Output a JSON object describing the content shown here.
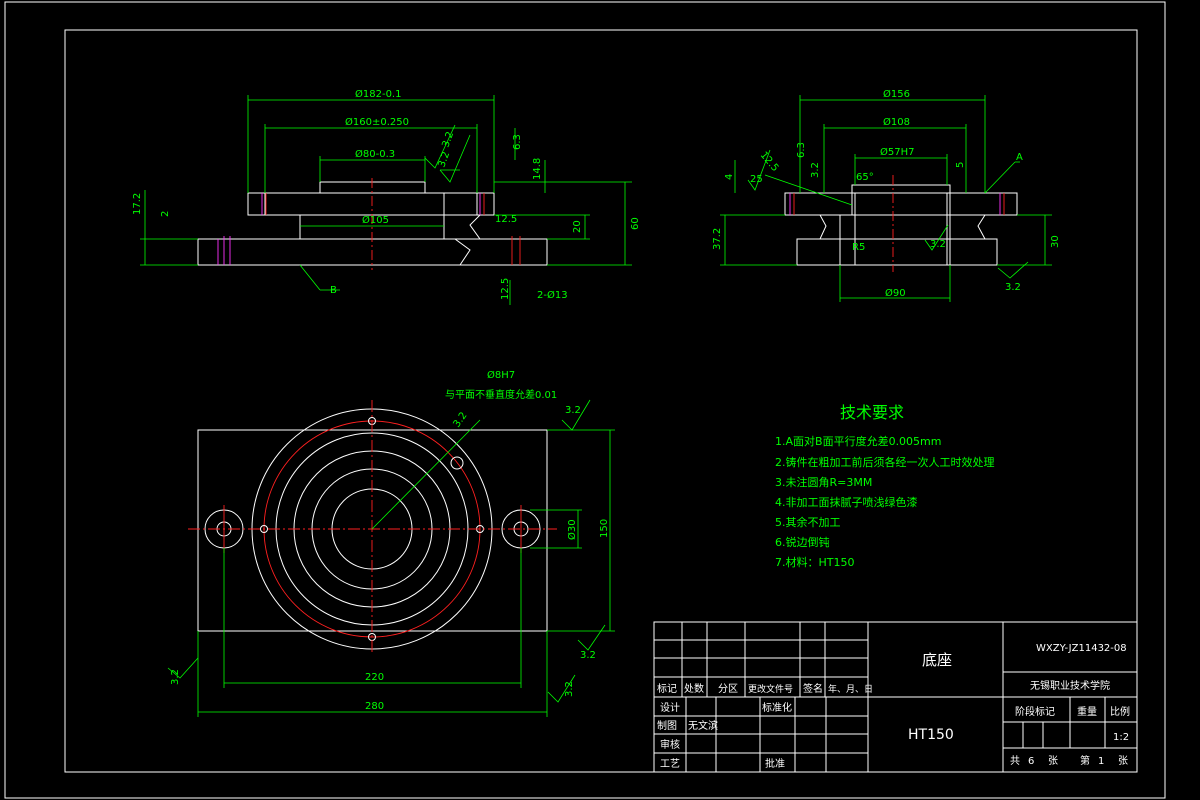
{
  "front_view": {
    "dims": {
      "d_outer": "Ø182-0.1",
      "d_mid": "Ø160±0.250",
      "d_inner": "Ø80-0.3",
      "d_base": "Ø105",
      "h1": "17.2",
      "h2": "2",
      "h3": "14.8",
      "h4": "6.3",
      "h5": "20",
      "h6": "60",
      "r1": "12.5",
      "r2": "12.5",
      "holes": "2-Ø13",
      "rough1": "3.2",
      "rough2": "3.2",
      "datum_b": "B"
    }
  },
  "side_view": {
    "dims": {
      "d_outer": "Ø156",
      "d_mid": "Ø108",
      "d_bore": "Ø57H7",
      "d_bottom": "Ø90",
      "h_left1": "4",
      "h_left2": "37.2",
      "h_right": "30",
      "chamfer1": "12.5",
      "chamfer2": "25",
      "angle1": "65°",
      "r_small": "R5",
      "rough_a": "3.2",
      "rough_b": "3.2",
      "rough_c": "3.2",
      "datum_a": "A",
      "num1": "5",
      "num2": "6.3"
    }
  },
  "top_view": {
    "note_bore": "Ø8H7",
    "note_perp": "与平面不垂直度允差0.01",
    "rough_top": "3.2",
    "rough_bore": "3.2",
    "rough_right": "3.2",
    "rough_left": "3.2",
    "rough_bottom": "3.2",
    "dim_width": "220",
    "dim_total": "280",
    "dim_height": "150",
    "dim_small": "Ø30"
  },
  "requirements": {
    "title": "技术要求",
    "items": [
      "1.A面对B面平行度允差0.005mm",
      "2.铸件在粗加工前后须各经一次人工时效处理",
      "3.未注圆角R=3MM",
      "4.非加工面抹腻子喷浅绿色漆",
      "5.其余不加工",
      "6.锐边倒钝",
      "7.材料：HT150"
    ]
  },
  "title_block": {
    "part_name": "底座",
    "material": "HT150",
    "drawing_no": "WXZY-JZ11432-08",
    "school": "无锡职业技术学院",
    "hdr_mark": "标记",
    "hdr_count": "处数",
    "hdr_zone": "分区",
    "hdr_doc": "更改文件号",
    "hdr_sign": "签名",
    "hdr_date": "年、月、日",
    "row_design": "设计",
    "row_draw": "制图",
    "drawer": "无文滨",
    "row_review": "审核",
    "row_process": "工艺",
    "std": "标准化",
    "approve": "批准",
    "stage": "阶段标记",
    "weight": "重量",
    "scale_label": "比例",
    "scale": "1:2",
    "total_label": "共",
    "total_num": "6",
    "sheet_unit1": "张",
    "page_label": "第",
    "page_num": "1",
    "sheet_unit2": "张"
  },
  "colors": {
    "background": "#000000",
    "outline": "#ffffff",
    "dimension": "#00ff00",
    "centerline": "#ff2020",
    "hidden": "#ff33ff"
  }
}
